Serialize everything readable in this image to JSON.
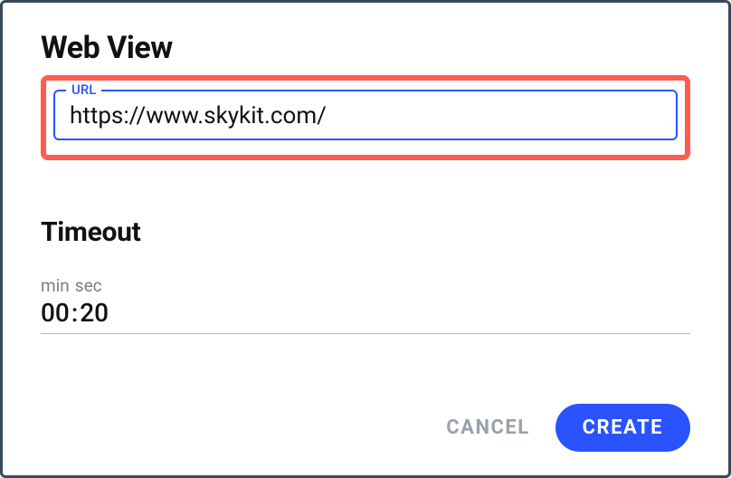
{
  "dialog": {
    "title": "Web View",
    "url_field": {
      "label": "URL",
      "value": "https://www.skykit.com/"
    },
    "timeout": {
      "title": "Timeout",
      "min_label": "min",
      "sec_label": "sec",
      "minutes": "00",
      "seconds": "20",
      "colon": ":"
    },
    "actions": {
      "cancel_label": "CANCEL",
      "create_label": "CREATE"
    }
  }
}
